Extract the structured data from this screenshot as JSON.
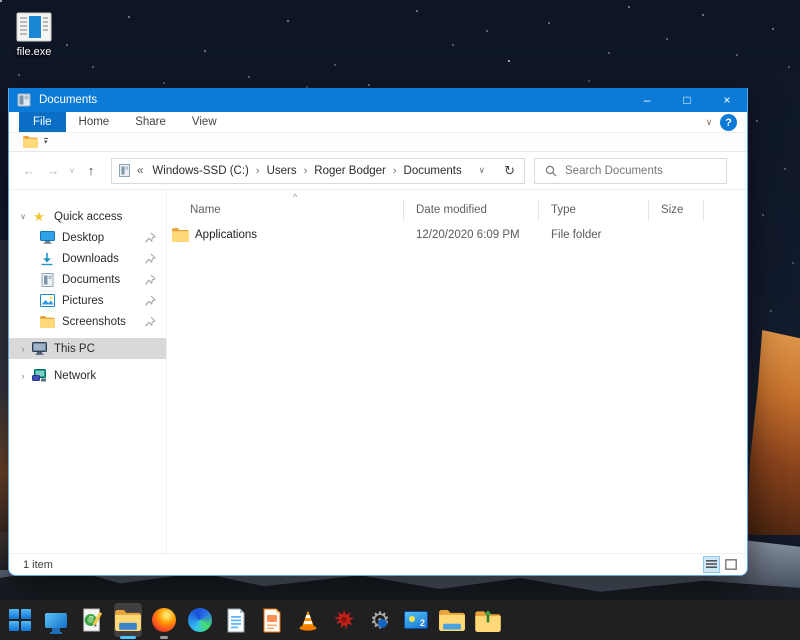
{
  "desktop": {
    "icon_label": "file.exe"
  },
  "window": {
    "title": "Documents",
    "ribbon_tabs": [
      {
        "label": "File"
      },
      {
        "label": "Home"
      },
      {
        "label": "Share"
      },
      {
        "label": "View"
      }
    ],
    "navigation": {
      "address_overflow": "«",
      "address_segments": [
        "Windows-SSD (C:)",
        "Users",
        "Roger Bodger",
        "Documents"
      ],
      "search_placeholder": "Search Documents"
    },
    "sidebar": {
      "items": [
        {
          "label": "Quick access"
        },
        {
          "label": "Desktop"
        },
        {
          "label": "Downloads"
        },
        {
          "label": "Documents"
        },
        {
          "label": "Pictures"
        },
        {
          "label": "Screenshots"
        },
        {
          "label": "This PC"
        },
        {
          "label": "Network"
        }
      ]
    },
    "file_list": {
      "columns": [
        "Name",
        "Date modified",
        "Type",
        "Size"
      ],
      "rows": [
        {
          "name": "Applications",
          "date_modified": "12/20/2020 6:09 PM",
          "type": "File folder",
          "size": ""
        }
      ]
    },
    "status": {
      "count": "1 item"
    }
  },
  "glyphs": {
    "minimize": "–",
    "maximize": "□",
    "close": "×",
    "back": "←",
    "forward": "→",
    "up": "↑",
    "chevron_down": "∨",
    "chevron_right": "›",
    "breadcrumb_sep": "›",
    "refresh": "↻",
    "sort_asc": "^",
    "help": "?",
    "star": "★",
    "gear": "⚙",
    "qat_arrow": "▾",
    "screen_label": "2"
  },
  "colors": {
    "titlebar": "#0c7bd7",
    "accent": "#0a6fc4",
    "selection": "#d9d9d9"
  },
  "taskbar": {
    "icons": [
      {
        "name": "start"
      },
      {
        "name": "monitor"
      },
      {
        "name": "html-editor"
      },
      {
        "name": "file-explorer",
        "active": true
      },
      {
        "name": "firefox",
        "running": true
      },
      {
        "name": "edge"
      },
      {
        "name": "writer-document"
      },
      {
        "name": "impress"
      },
      {
        "name": "vlc"
      },
      {
        "name": "paint-splatter"
      },
      {
        "name": "settings"
      },
      {
        "name": "display-media"
      },
      {
        "name": "folder"
      },
      {
        "name": "folder-upload"
      }
    ]
  }
}
